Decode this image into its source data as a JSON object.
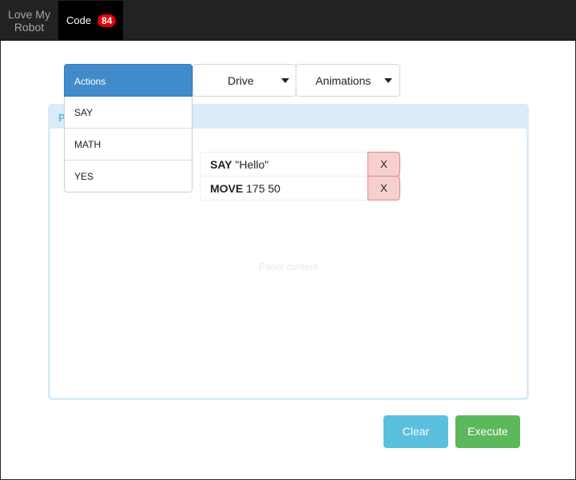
{
  "navbar": {
    "brand": "Love My Robot",
    "code_tab": {
      "label": "Code",
      "badge": "84"
    }
  },
  "toolbar": {
    "actions": {
      "label": "Actions",
      "items": [
        "SAY",
        "MATH",
        "YES"
      ]
    },
    "drive": {
      "label": "Drive"
    },
    "animations": {
      "label": "Animations"
    }
  },
  "panel": {
    "heading": "P",
    "placeholder": "Panel content",
    "commands": [
      {
        "keyword": "SAY",
        "args": "\"Hello\"",
        "remove_label": "X"
      },
      {
        "keyword": "MOVE",
        "args": "175 50",
        "remove_label": "X"
      }
    ]
  },
  "footer": {
    "clear_label": "Clear",
    "execute_label": "Execute"
  },
  "colors": {
    "navbar": "#222222",
    "primary": "#428bca",
    "info": "#5bc0de",
    "success": "#5cb85c",
    "danger_bg": "#f6cfcf",
    "badge": "#e20000"
  }
}
